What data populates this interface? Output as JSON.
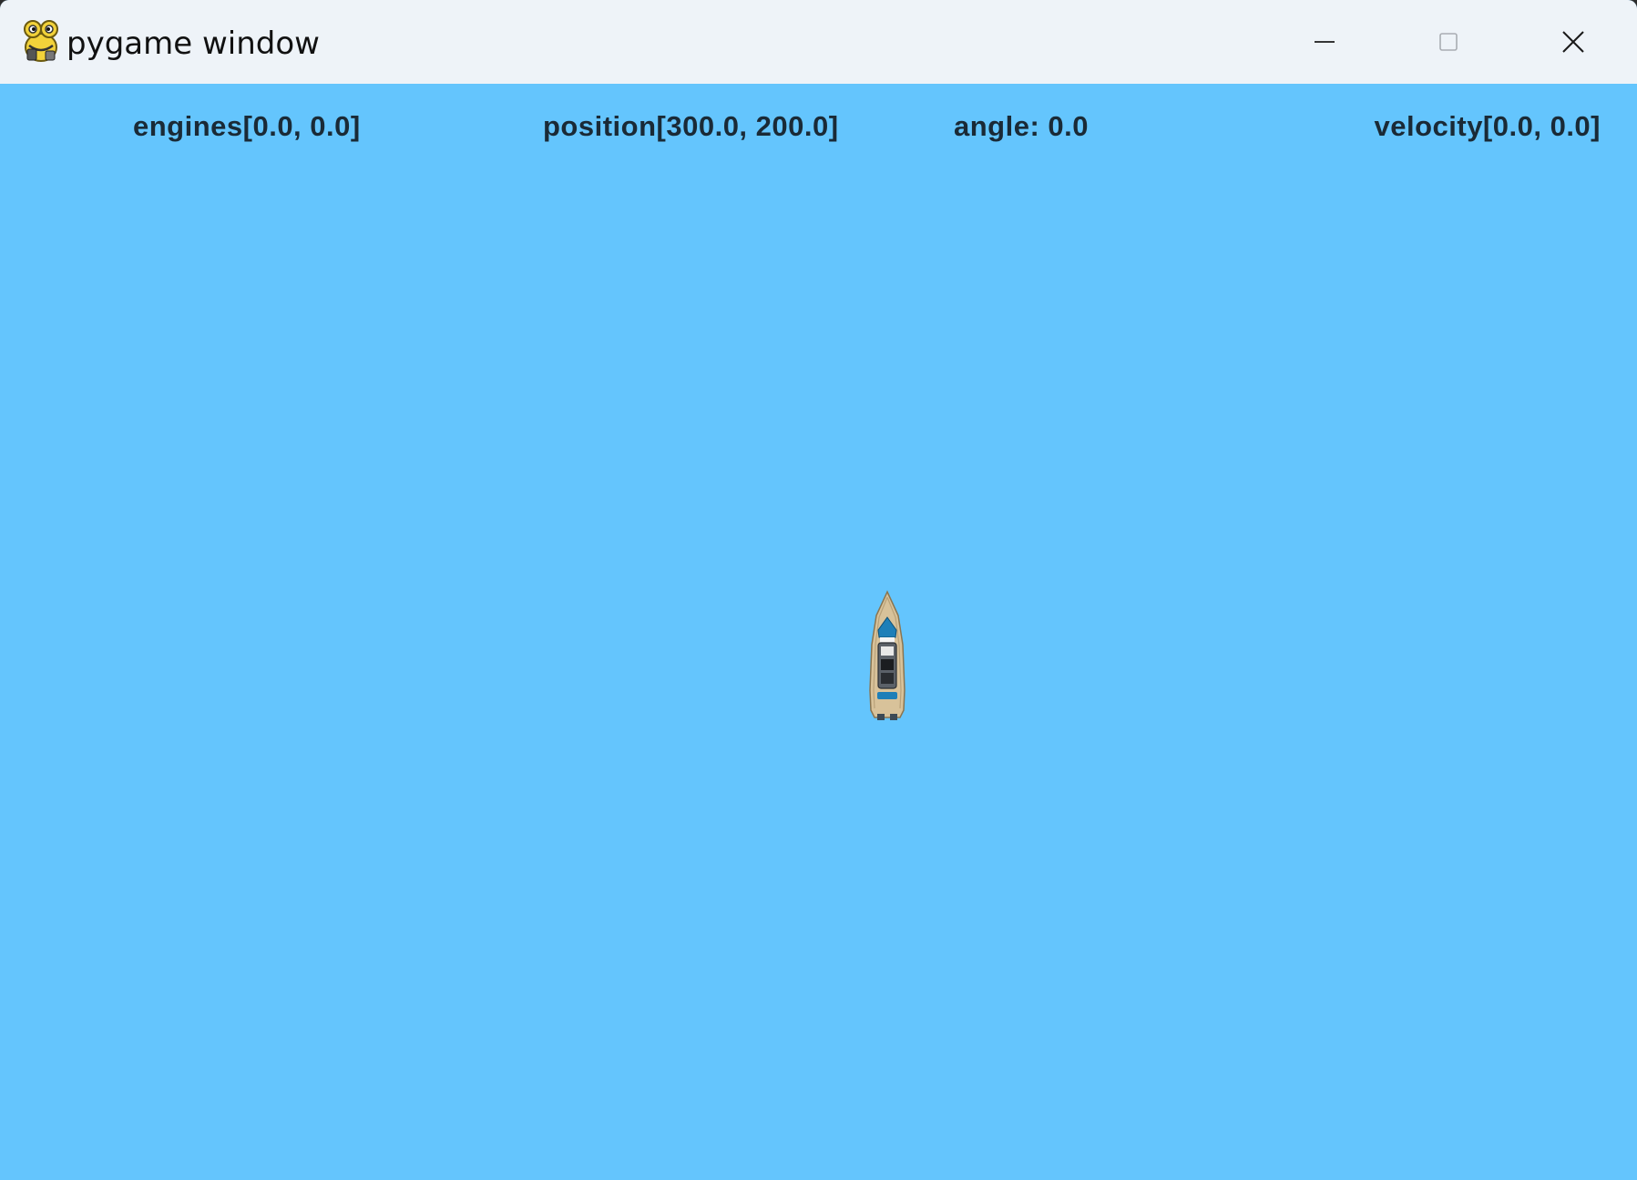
{
  "window": {
    "title": "pygame window",
    "icon": "pygame-snake-icon",
    "controls": {
      "minimize_icon": "minimize-icon",
      "maximize_icon": "maximize-icon",
      "close_icon": "close-icon"
    }
  },
  "game": {
    "background_color": "#64c5fd",
    "hud": {
      "engines": "engines[0.0, 0.0]",
      "position": "position[300.0, 200.0]",
      "angle": "angle: 0.0",
      "velocity": "velocity[0.0, 0.0]"
    },
    "boat": {
      "icon": "speedboat-sprite",
      "hull_color": "#d8c29a",
      "accent_color": "#1e7fb8"
    }
  }
}
